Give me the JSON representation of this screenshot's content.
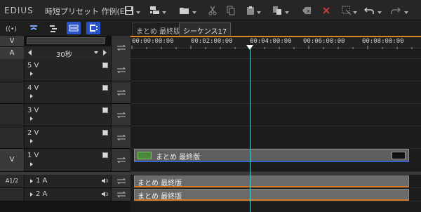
{
  "app": {
    "brand": "EDIUS",
    "project_title": "時短プリセット 作例(E..."
  },
  "toolbar": {
    "icons": [
      "save-icon",
      "new-sequence-icon",
      "open-icon",
      "cut-icon",
      "copy-icon",
      "paste-icon",
      "paste-insert-icon",
      "delete-icon",
      "ripple-delete-icon",
      "delete-marker-icon",
      "undo-icon",
      "redo-icon"
    ]
  },
  "modes": {
    "icons": [
      "audio-monitor-icon",
      "snap-icon",
      "sync-mode-icon",
      "link-mode-icon",
      "clip-mode-icon"
    ]
  },
  "tabs": [
    {
      "label": "まとめ 最終版"
    },
    {
      "label": "シーケンス17"
    }
  ],
  "track_header": {
    "v_label": "V",
    "a_label": "A",
    "scale_value": "30秒",
    "v_tracks": [
      {
        "name": "5 V"
      },
      {
        "name": "4 V"
      },
      {
        "name": "3 V"
      },
      {
        "name": "2 V"
      },
      {
        "name": "1 V",
        "patch": "V"
      }
    ],
    "a_tracks": [
      {
        "name": "1 A",
        "patch": "A1/2"
      },
      {
        "name": "2 A"
      }
    ]
  },
  "ruler": {
    "timecodes": [
      "00:00:00:00",
      "00:02:00:00",
      "00:04:00:00",
      "00:06:00:00",
      "00:08:00:00"
    ]
  },
  "clips": {
    "video_1v": "まとめ 最終版",
    "audio_1a": "まとめ 最終版",
    "audio_2a": "まとめ 最終版"
  },
  "colors": {
    "accent": "#2a54c8",
    "playhead": "#4fd2d2",
    "ruler_bar": "#d88a20"
  }
}
